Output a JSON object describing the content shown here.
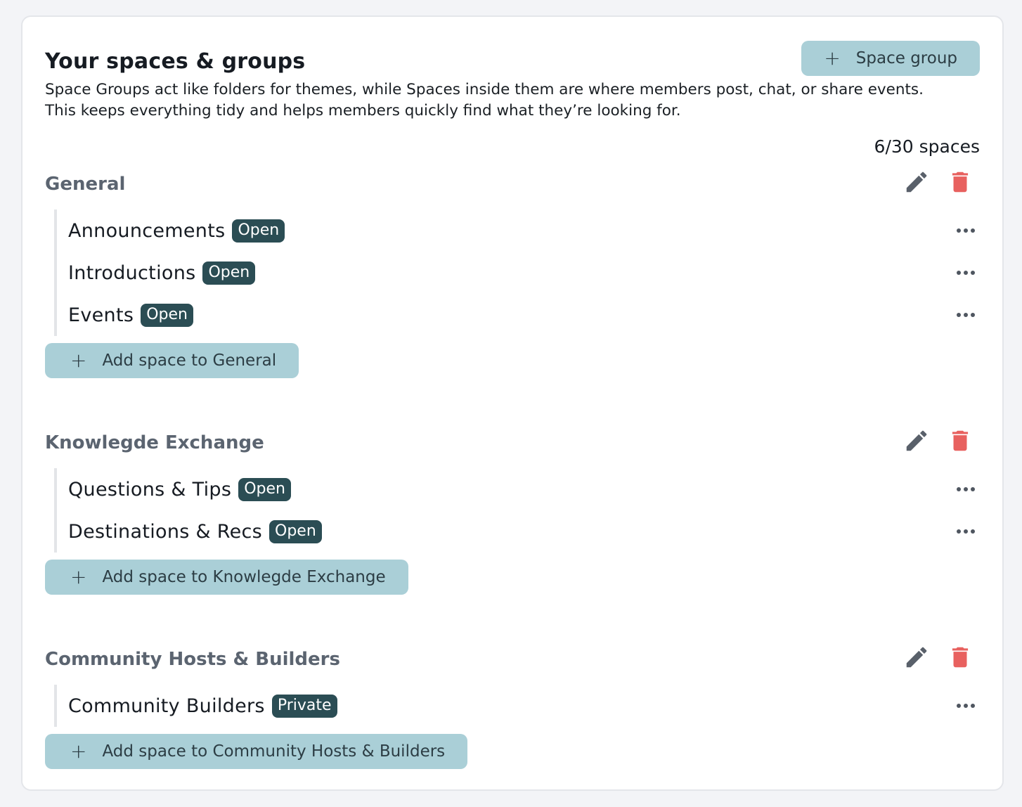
{
  "page": {
    "title": "Your spaces & groups",
    "new_group_button": "Space group",
    "description_line1": "Space Groups act like folders for themes, while Spaces inside them are where members post, chat, or share events.",
    "description_line2": "This keeps everything tidy and helps members quickly find what they’re looking for.",
    "space_count": "6/30 spaces"
  },
  "icons": {
    "plus": "plus-icon",
    "edit": "pencil-icon",
    "delete": "trash-icon",
    "more": "more-horizontal-icon"
  },
  "colors": {
    "accent_button_bg": "#aacfd7",
    "badge_bg": "#2b4d54",
    "delete_red": "#e8615f",
    "edit_gray": "#59606a"
  },
  "groups": [
    {
      "name": "General",
      "spaces": [
        {
          "name": "Announcements",
          "visibility": "Open"
        },
        {
          "name": "Introductions",
          "visibility": "Open"
        },
        {
          "name": "Events",
          "visibility": "Open"
        }
      ],
      "add_label": "Add space to General"
    },
    {
      "name": "Knowlegde Exchange",
      "spaces": [
        {
          "name": "Questions & Tips",
          "visibility": "Open"
        },
        {
          "name": "Destinations & Recs",
          "visibility": "Open"
        }
      ],
      "add_label": "Add space to Knowlegde Exchange"
    },
    {
      "name": "Community Hosts & Builders",
      "spaces": [
        {
          "name": "Community Builders",
          "visibility": "Private"
        }
      ],
      "add_label": "Add space to Community Hosts & Builders"
    }
  ]
}
